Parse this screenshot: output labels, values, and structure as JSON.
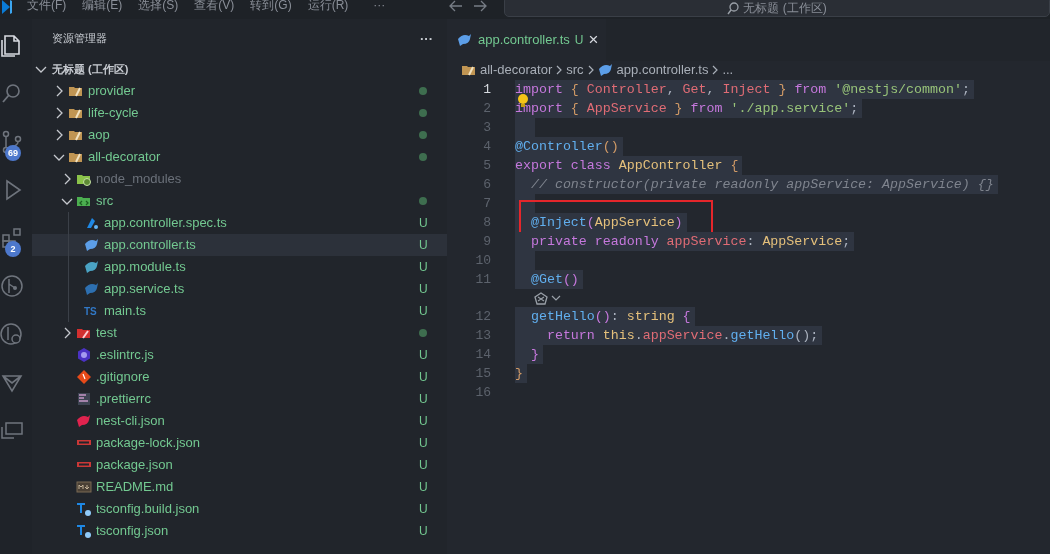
{
  "menu": {
    "items": [
      "文件(F)",
      "编辑(E)",
      "选择(S)",
      "查看(V)",
      "转到(G)",
      "运行(R)"
    ],
    "more": "···"
  },
  "command_center": {
    "text": "无标题 (工作区)"
  },
  "activity_bar": [
    {
      "kind": "files",
      "selected": true
    },
    {
      "kind": "search",
      "selected": false
    },
    {
      "kind": "source-control",
      "selected": false,
      "badge": "69"
    },
    {
      "kind": "run",
      "selected": false
    },
    {
      "kind": "extensions",
      "selected": false,
      "badge": "2"
    },
    {
      "kind": "git-graph",
      "selected": false
    },
    {
      "kind": "debug-search",
      "selected": false
    },
    {
      "kind": "deploy",
      "selected": false
    },
    {
      "kind": "remote",
      "selected": false
    }
  ],
  "sidebar": {
    "title": "资源管理器",
    "more": "···",
    "workspace": {
      "label": "无标题 (工作区)",
      "expanded": true,
      "children": [
        {
          "label": "provider",
          "kind": "folder",
          "expanded": false,
          "dot": true,
          "ignored": false,
          "selected": false
        },
        {
          "label": "life-cycle",
          "kind": "folder",
          "expanded": false,
          "dot": true,
          "ignored": false,
          "selected": false
        },
        {
          "label": "aop",
          "kind": "folder",
          "expanded": false,
          "dot": true,
          "ignored": false,
          "selected": false
        },
        {
          "label": "all-decorator",
          "kind": "folder",
          "expanded": true,
          "dot": true,
          "ignored": false,
          "selected": false,
          "children": [
            {
              "label": "node_modules",
              "kind": "node-folder",
              "expanded": false,
              "dot": false,
              "ignored": true,
              "selected": false
            },
            {
              "label": "src",
              "kind": "src-folder",
              "expanded": true,
              "dot": true,
              "ignored": false,
              "selected": false,
              "children": [
                {
                  "label": "app.controller.spec.ts",
                  "kind": "spec",
                  "decoration": "U",
                  "ignored": false,
                  "selected": false
                },
                {
                  "label": "app.controller.ts",
                  "kind": "nest-controller",
                  "decoration": "U",
                  "ignored": false,
                  "selected": true
                },
                {
                  "label": "app.module.ts",
                  "kind": "nest-module",
                  "decoration": "U",
                  "ignored": false,
                  "selected": false
                },
                {
                  "label": "app.service.ts",
                  "kind": "nest-service",
                  "decoration": "U",
                  "ignored": false,
                  "selected": false
                },
                {
                  "label": "main.ts",
                  "kind": "ts",
                  "badge": "TS",
                  "decoration": "U",
                  "ignored": false,
                  "selected": false
                }
              ]
            },
            {
              "label": "test",
              "kind": "test-folder",
              "expanded": false,
              "dot": true,
              "ignored": false,
              "selected": false
            },
            {
              "label": ".eslintrc.js",
              "kind": "eslint",
              "decoration": "U",
              "ignored": false,
              "selected": false
            },
            {
              "label": ".gitignore",
              "kind": "git",
              "decoration": "U",
              "ignored": false,
              "selected": false
            },
            {
              "label": ".prettierrc",
              "kind": "prettier",
              "decoration": "U",
              "ignored": false,
              "selected": false
            },
            {
              "label": "nest-cli.json",
              "kind": "nest",
              "decoration": "U",
              "ignored": false,
              "selected": false
            },
            {
              "label": "package-lock.json",
              "kind": "npm",
              "decoration": "U",
              "ignored": false,
              "selected": false
            },
            {
              "label": "package.json",
              "kind": "npm",
              "decoration": "U",
              "ignored": false,
              "selected": false
            },
            {
              "label": "README.md",
              "kind": "markdown",
              "decoration": "U",
              "ignored": false,
              "selected": false
            },
            {
              "label": "tsconfig.build.json",
              "kind": "tsconfig",
              "decoration": "U",
              "ignored": false,
              "selected": false
            },
            {
              "label": "tsconfig.json",
              "kind": "tsconfig",
              "decoration": "U",
              "ignored": false,
              "selected": false
            }
          ]
        }
      ]
    }
  },
  "tabs": [
    {
      "label": "app.controller.ts",
      "status": "U",
      "close": "×",
      "selected": true
    }
  ],
  "breadcrumb": [
    "all-decorator",
    "src",
    "app.controller.ts",
    "..."
  ],
  "code_lines": [
    {
      "kind": "line",
      "number": "1",
      "current": true,
      "highlighted": true,
      "tokens": [
        {
          "text": "import",
          "kind": "keyword"
        },
        {
          "text": " { ",
          "kind": "bracket"
        },
        {
          "text": "Controller",
          "kind": "variable"
        },
        {
          "text": ", ",
          "kind": "punct"
        },
        {
          "text": "Get",
          "kind": "variable"
        },
        {
          "text": ", ",
          "kind": "punct"
        },
        {
          "text": "Inject",
          "kind": "variable"
        },
        {
          "text": " } ",
          "kind": "bracket"
        },
        {
          "text": "from ",
          "kind": "keyword"
        },
        {
          "text": "'@nestjs/common'",
          "kind": "string"
        },
        {
          "text": ";",
          "kind": "punct"
        }
      ]
    },
    {
      "kind": "line",
      "number": "2",
      "current": false,
      "highlighted": true,
      "lightbulb": true,
      "tokens": [
        {
          "text": "import",
          "kind": "keyword"
        },
        {
          "text": " { ",
          "kind": "bracket"
        },
        {
          "text": "AppService",
          "kind": "variable"
        },
        {
          "text": " } ",
          "kind": "bracket"
        },
        {
          "text": "from ",
          "kind": "keyword"
        },
        {
          "text": "'./app.service'",
          "kind": "string"
        },
        {
          "text": ";",
          "kind": "punct"
        }
      ]
    },
    {
      "kind": "line",
      "number": "3",
      "current": false,
      "highlighted": true
    },
    {
      "kind": "line",
      "number": "4",
      "current": false,
      "highlighted": true,
      "tokens": [
        {
          "text": "@Controller",
          "kind": "function"
        },
        {
          "text": "()",
          "kind": "bracket"
        }
      ]
    },
    {
      "kind": "line",
      "number": "5",
      "current": false,
      "highlighted": true,
      "tokens": [
        {
          "text": "export class ",
          "kind": "keyword"
        },
        {
          "text": "AppController",
          "kind": "type"
        },
        {
          "text": " {",
          "kind": "bracket"
        }
      ]
    },
    {
      "kind": "line",
      "number": "6",
      "current": false,
      "highlighted": true,
      "tokens": [
        {
          "text": "  // constructor(private readonly appService: AppService) {}",
          "kind": "comment"
        }
      ]
    },
    {
      "kind": "line",
      "number": "7",
      "current": false,
      "highlighted": true
    },
    {
      "kind": "line",
      "number": "8",
      "current": false,
      "highlighted": true,
      "boxed": true,
      "tokens": [
        {
          "text": "  @Inject",
          "kind": "function"
        },
        {
          "text": "(",
          "kind": "bracket2"
        },
        {
          "text": "AppService",
          "kind": "type"
        },
        {
          "text": ")",
          "kind": "bracket2"
        }
      ]
    },
    {
      "kind": "line",
      "number": "9",
      "current": false,
      "highlighted": true,
      "tokens": [
        {
          "text": "  private readonly ",
          "kind": "keyword"
        },
        {
          "text": "appService",
          "kind": "variable"
        },
        {
          "text": ": ",
          "kind": "punct"
        },
        {
          "text": "AppService",
          "kind": "type"
        },
        {
          "text": ";",
          "kind": "punct"
        }
      ]
    },
    {
      "kind": "line",
      "number": "10",
      "current": false,
      "highlighted": true
    },
    {
      "kind": "line",
      "number": "11",
      "current": false,
      "highlighted": true,
      "tokens": [
        {
          "text": "  @Get",
          "kind": "function"
        },
        {
          "text": "()",
          "kind": "bracket2"
        }
      ]
    },
    {
      "kind": "codelens"
    },
    {
      "kind": "line",
      "number": "12",
      "current": false,
      "highlighted": true,
      "tokens": [
        {
          "text": "  getHello",
          "kind": "function"
        },
        {
          "text": "()",
          "kind": "bracket2"
        },
        {
          "text": ": ",
          "kind": "punct"
        },
        {
          "text": "string",
          "kind": "type"
        },
        {
          "text": " {",
          "kind": "bracket2"
        }
      ]
    },
    {
      "kind": "line",
      "number": "13",
      "current": false,
      "highlighted": true,
      "tokens": [
        {
          "text": "    return ",
          "kind": "keyword"
        },
        {
          "text": "this",
          "kind": "type"
        },
        {
          "text": ".",
          "kind": "punct"
        },
        {
          "text": "appService",
          "kind": "variable"
        },
        {
          "text": ".",
          "kind": "punct"
        },
        {
          "text": "getHello",
          "kind": "function"
        },
        {
          "text": "();",
          "kind": "punct"
        }
      ]
    },
    {
      "kind": "line",
      "number": "14",
      "current": false,
      "highlighted": true,
      "tokens": [
        {
          "text": "  }",
          "kind": "bracket2"
        }
      ]
    },
    {
      "kind": "line",
      "number": "15",
      "current": false,
      "highlighted": true,
      "tokens": [
        {
          "text": "}",
          "kind": "bracket"
        }
      ]
    },
    {
      "kind": "line",
      "number": "16",
      "current": false,
      "highlighted": false
    }
  ]
}
